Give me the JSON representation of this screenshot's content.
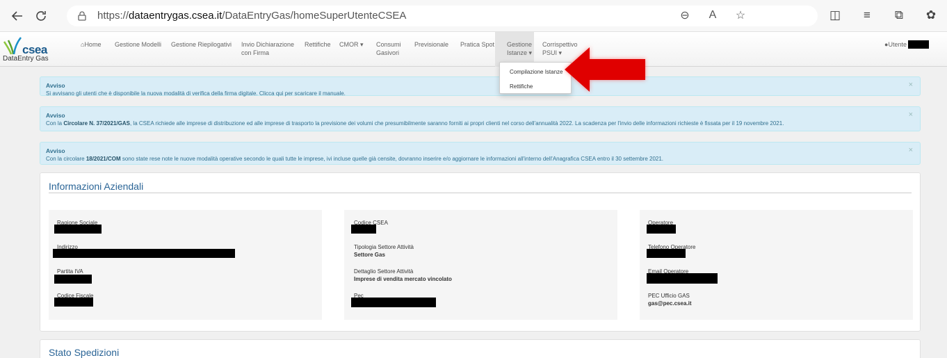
{
  "browser": {
    "url_scheme": "https://",
    "url_host": "dataentrygas.csea.it",
    "url_path": "/DataEntryGas/homeSuperUtenteCSEA"
  },
  "app": {
    "brand": "csea",
    "brand_sub": "DataEntry Gas"
  },
  "nav": {
    "home": "Home",
    "gestione_modelli": "Gestione Modelli",
    "gestione_riepilogativi": "Gestione Riepilogativi",
    "invio_l1": "Invio Dichiarazione",
    "invio_l2": "con Firma",
    "rettifiche": "Rettifiche",
    "cmor": "CMOR",
    "consumi_l1": "Consumi",
    "consumi_l2": "Gasivori",
    "previsionale": "Previsionale",
    "pratica_spot": "Pratica Spot",
    "gestione_l1": "Gestione",
    "gestione_l2": "Istanze",
    "corrispettivo_l1": "Corrispettivo",
    "corrispettivo_l2": "PSUI",
    "user": "Utente"
  },
  "dropdown": {
    "item1": "Compilazione Istanze",
    "item2": "Rettifiche"
  },
  "alerts": [
    {
      "title": "Avviso",
      "text": "Si avvisano gli utenti che è disponibile la nuova modalità di verifica della firma digitale. Clicca qui per scaricare il manuale."
    },
    {
      "title": "Avviso",
      "pre": "Con la ",
      "bold": "Circolare N. 37/2021/GAS",
      "post": ", la CSEA richiede alle imprese di distribuzione ed alle imprese di trasporto la previsione dei volumi che presumibilmente saranno forniti ai propri clienti nel corso dell'annualità 2022. La scadenza per l'invio delle informazioni richieste è fissata per il 19 novembre 2021."
    },
    {
      "title": "Avviso",
      "pre": "Con la circolare ",
      "bold": "18/2021/COM",
      "post": " sono state rese note le nuove modalità operative secondo le quali tutte le imprese, ivi incluse quelle già censite, dovranno inserire e/o aggiornare le informazioni all'interno dell'Anagrafica CSEA entro il 30 settembre 2021."
    }
  ],
  "info_panel": {
    "title": "Informazioni Aziendali",
    "col1": {
      "ragione_sociale": "Ragione Sociale",
      "indirizzo": "Indirizzo",
      "partita_iva": "Partita IVA",
      "codice_fiscale": "Codice Fiscale"
    },
    "col2": {
      "codice_csea": "Codice CSEA",
      "tipologia_label": "Tipologia Settore Attività",
      "tipologia_value": "Settore Gas",
      "dettaglio_label": "Dettaglio Settore Attività",
      "dettaglio_value": "Imprese di vendita mercato vincolato",
      "pec": "Pec"
    },
    "col3": {
      "operatore": "Operatore",
      "telefono": "Telefono Operatore",
      "email": "Email Operatore",
      "pec_ufficio_label": "PEC Ufficio GAS",
      "pec_ufficio_value": "gas@pec.csea.it"
    }
  },
  "spedizioni_panel": {
    "title": "Stato Spedizioni"
  },
  "colors": {
    "alert_bg": "#d9edf7",
    "alert_text": "#31708f",
    "panel_title": "#2a6496",
    "arrow": "#e00000"
  }
}
